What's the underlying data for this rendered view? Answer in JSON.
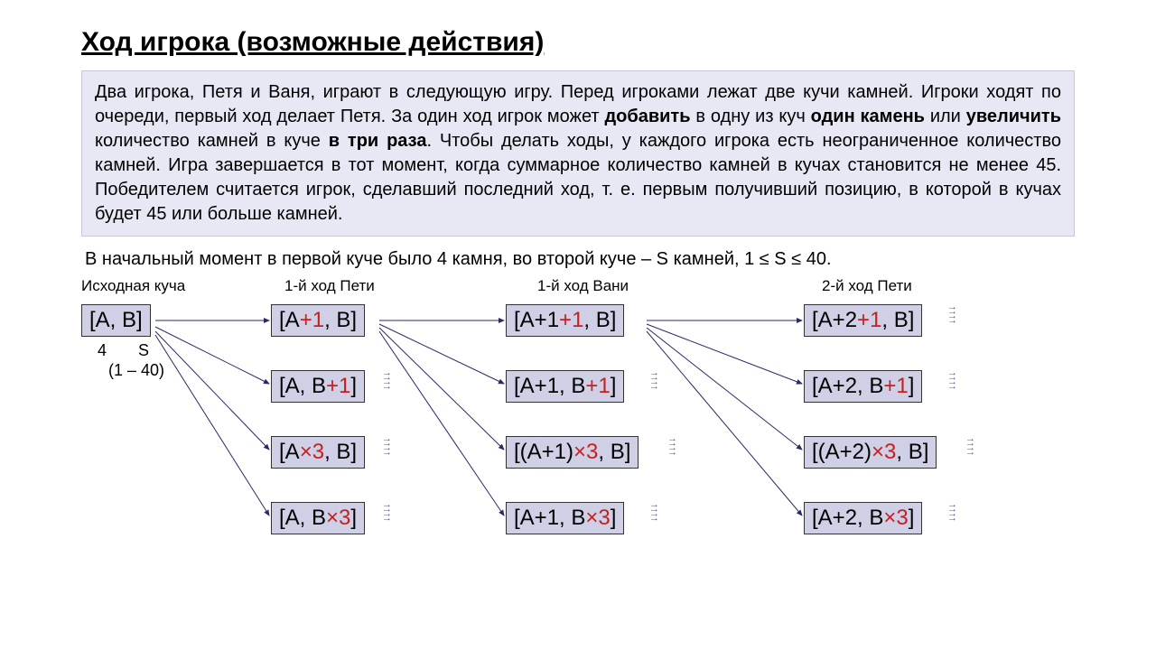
{
  "title": "Ход игрока (возможные действия)",
  "panel": {
    "pre": "Два игрока, Петя и Ваня, играют в следующую игру. Перед игроками лежат две кучи камней. Игроки ходят по очереди, первый ход делает Петя. За один ход игрок может ",
    "b1": "добавить",
    "mid1": " в одну из куч ",
    "b2": "один камень",
    "mid2": " или ",
    "b3": "увеличить",
    "mid3": " количество камней в куче ",
    "b4": "в три раза",
    "post": ". Чтобы делать ходы, у каждого игрока есть неограниченное количество камней. Игра завершается в тот момент, когда суммарное количество камней в кучах становится не менее 45. Победителем считается игрок, сделавший последний ход, т. е. первым получивший позицию, в которой в кучах будет 45 или больше камней."
  },
  "note": "В начальный момент в первой куче было 4 камня, во второй куче – S камней, 1 ≤ S ≤ 40.",
  "heads": {
    "c0": "Исходная  куча",
    "c1": "1-й  ход  Пети",
    "c2": "1-й  ход  Вани",
    "c3": "2-й  ход  Пети"
  },
  "cells": {
    "root": "[A, B]",
    "sub1": "4       S",
    "sub2": "(1 – 40)",
    "c1r1_a": "[A",
    "c1r1_op": "+1",
    "c1r1_b": ", B]",
    "c1r2_a": "[A, B",
    "c1r2_op": "+1",
    "c1r2_b": "]",
    "c1r3_a": "[A",
    "c1r3_op": "×3",
    "c1r3_b": ", B]",
    "c1r4_a": "[A, B",
    "c1r4_op": "×3",
    "c1r4_b": "]",
    "c2r1_a": "[A+1",
    "c2r1_op": "+1",
    "c2r1_b": ", B]",
    "c2r2_a": "[A+1, B",
    "c2r2_op": "+1",
    "c2r2_b": "]",
    "c2r3_a": "[(A+1)",
    "c2r3_op": "×3",
    "c2r3_b": ", B]",
    "c2r4_a": "[A+1, B",
    "c2r4_op": "×3",
    "c2r4_b": "]",
    "c3r1_a": "[A+2",
    "c3r1_op": "+1",
    "c3r1_b": ", B]",
    "c3r2_a": "[A+2, B",
    "c3r2_op": "+1",
    "c3r2_b": "]",
    "c3r3_a": "[(A+2)",
    "c3r3_op": "×3",
    "c3r3_b": ", B]",
    "c3r4_a": "[A+2, B",
    "c3r4_op": "×3",
    "c3r4_b": "]"
  }
}
